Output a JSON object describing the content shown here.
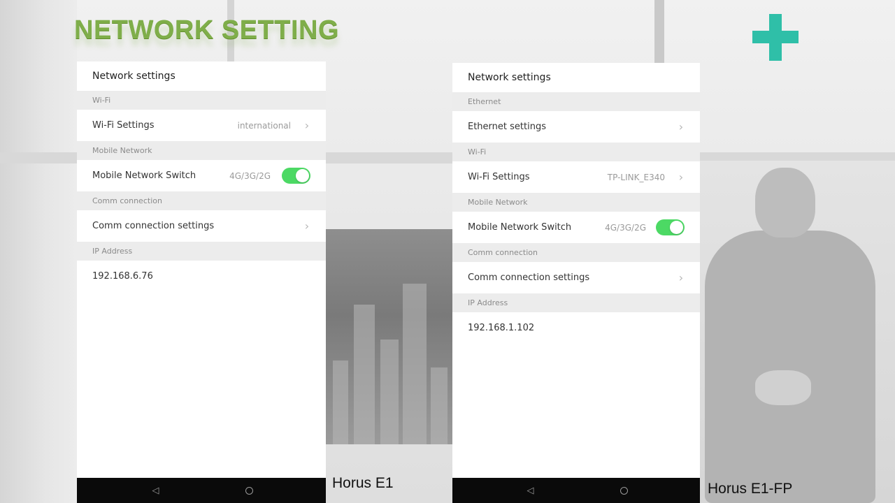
{
  "heading": "NETWORK SETTING",
  "accent_color": "#2fbfa8",
  "heading_color": "#7fae4a",
  "toggle_color": "#4cd964",
  "devices": [
    {
      "caption": "Horus E1",
      "screen_title": "Network settings",
      "sections": {
        "wifi": {
          "header": "Wi-Fi",
          "row_label": "Wi-Fi Settings",
          "row_value": "international"
        },
        "mobile": {
          "header": "Mobile Network",
          "row_label": "Mobile Network Switch",
          "row_value": "4G/3G/2G",
          "toggle_on": true
        },
        "comm": {
          "header": "Comm connection",
          "row_label": "Comm connection settings"
        },
        "ip": {
          "header": "IP Address",
          "value": "192.168.6.76"
        }
      }
    },
    {
      "caption": "Horus E1-FP",
      "screen_title": "Network settings",
      "sections": {
        "ethernet": {
          "header": "Ethernet",
          "row_label": "Ethernet settings"
        },
        "wifi": {
          "header": "Wi-Fi",
          "row_label": "Wi-Fi Settings",
          "row_value": "TP-LINK_E340"
        },
        "mobile": {
          "header": "Mobile Network",
          "row_label": "Mobile Network Switch",
          "row_value": "4G/3G/2G",
          "toggle_on": true
        },
        "comm": {
          "header": "Comm connection",
          "row_label": "Comm connection settings"
        },
        "ip": {
          "header": "IP Address",
          "value": "192.168.1.102"
        }
      }
    }
  ],
  "nav_icons": [
    "back-icon",
    "home-icon"
  ]
}
